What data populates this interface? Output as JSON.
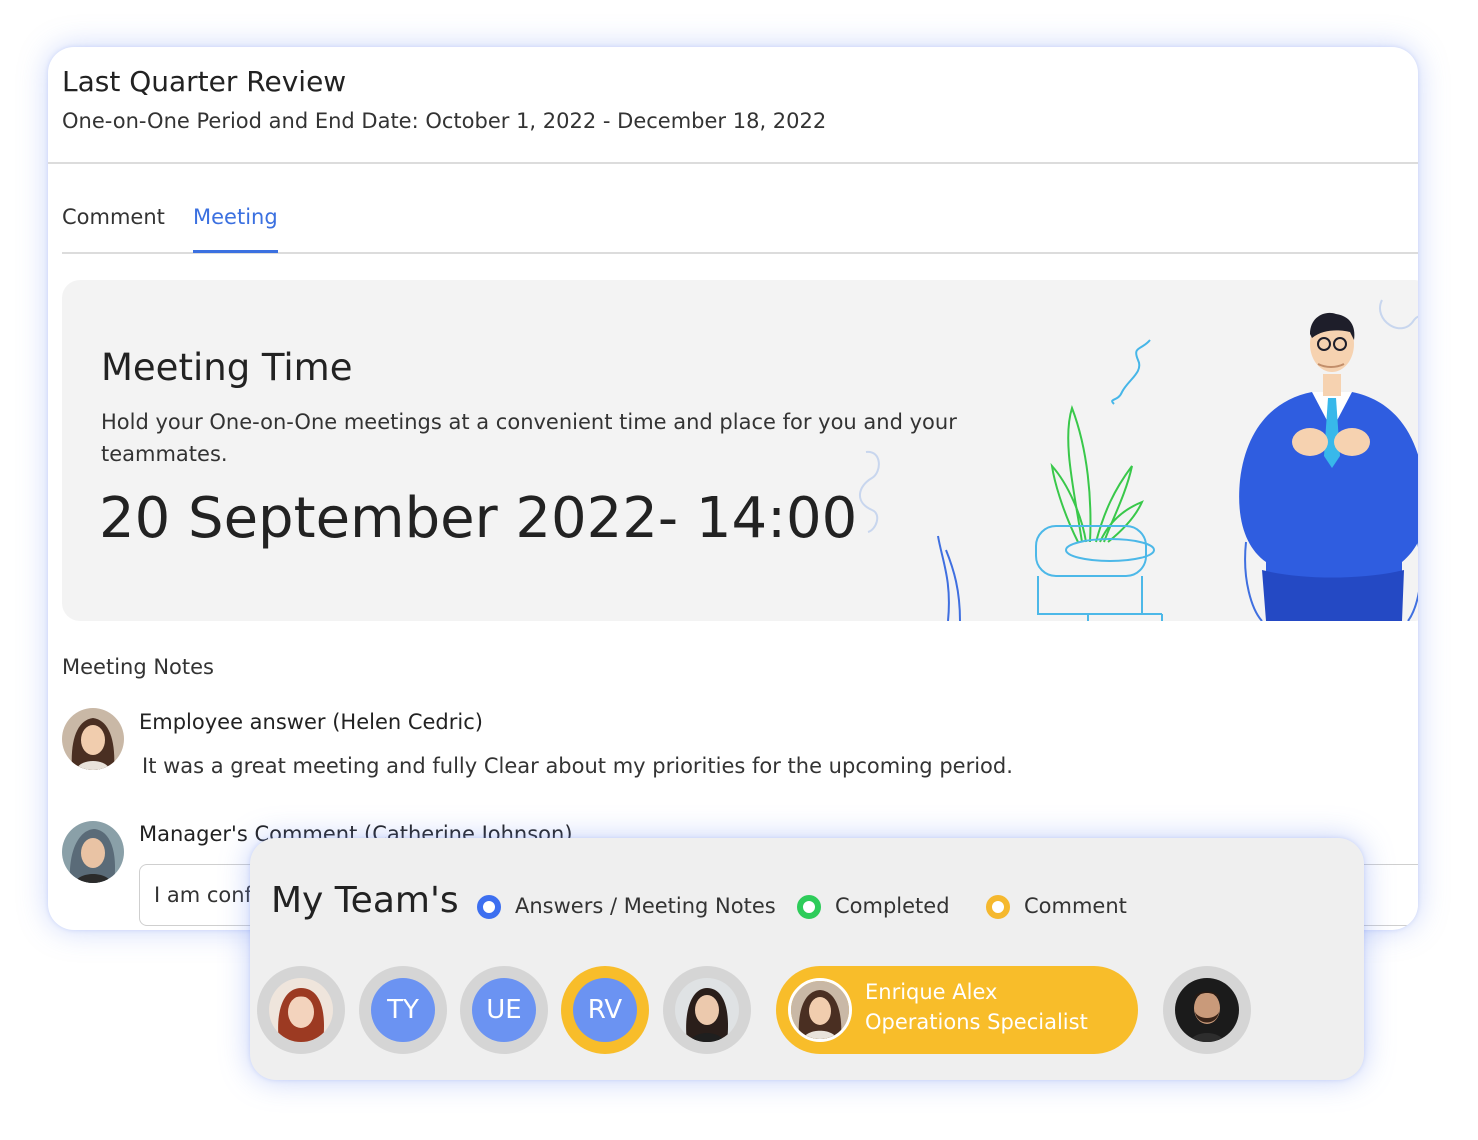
{
  "review": {
    "title": "Last Quarter Review",
    "subtitle": "One-on-One Period and End Date: October 1, 2022 - December 18, 2022"
  },
  "tabs": [
    {
      "label": "Comment",
      "active": false
    },
    {
      "label": "Meeting",
      "active": true
    }
  ],
  "meeting": {
    "title": "Meeting Time",
    "description": "Hold your One-on-One meetings at a convenient time and place for you and your teammates.",
    "datetime": "20 September 2022- 14:00"
  },
  "notes": {
    "title": "Meeting Notes",
    "employee": {
      "name": "Employee answer (Helen Cedric)",
      "text": "It was a great meeting and fully Clear about my priorities for the upcoming period."
    },
    "manager": {
      "name": "Manager's Comment (Catherine Johnson)",
      "input_value": "I am confident"
    }
  },
  "team": {
    "title": "My Team's",
    "legend": [
      {
        "label": "Answers / Meeting Notes",
        "color": "#3d6ff0"
      },
      {
        "label": "Completed",
        "color": "#2ecc5a"
      },
      {
        "label": "Comment",
        "color": "#f5b82e"
      }
    ],
    "members": [
      {
        "type": "photo",
        "icon": "avatar-woman-red-hair"
      },
      {
        "type": "initials",
        "initials": "TY"
      },
      {
        "type": "initials",
        "initials": "UE"
      },
      {
        "type": "initials",
        "initials": "RV",
        "highlight": true
      },
      {
        "type": "photo",
        "icon": "avatar-woman-dark-hair"
      },
      {
        "type": "selected",
        "name": "Enrique Alex",
        "role": "Operations Specialist"
      },
      {
        "type": "photo",
        "icon": "avatar-man-beard"
      }
    ]
  },
  "colors": {
    "accent_blue": "#3b70e0",
    "highlight_yellow": "#f8bd2a",
    "initials_blue": "#6b93f2"
  }
}
